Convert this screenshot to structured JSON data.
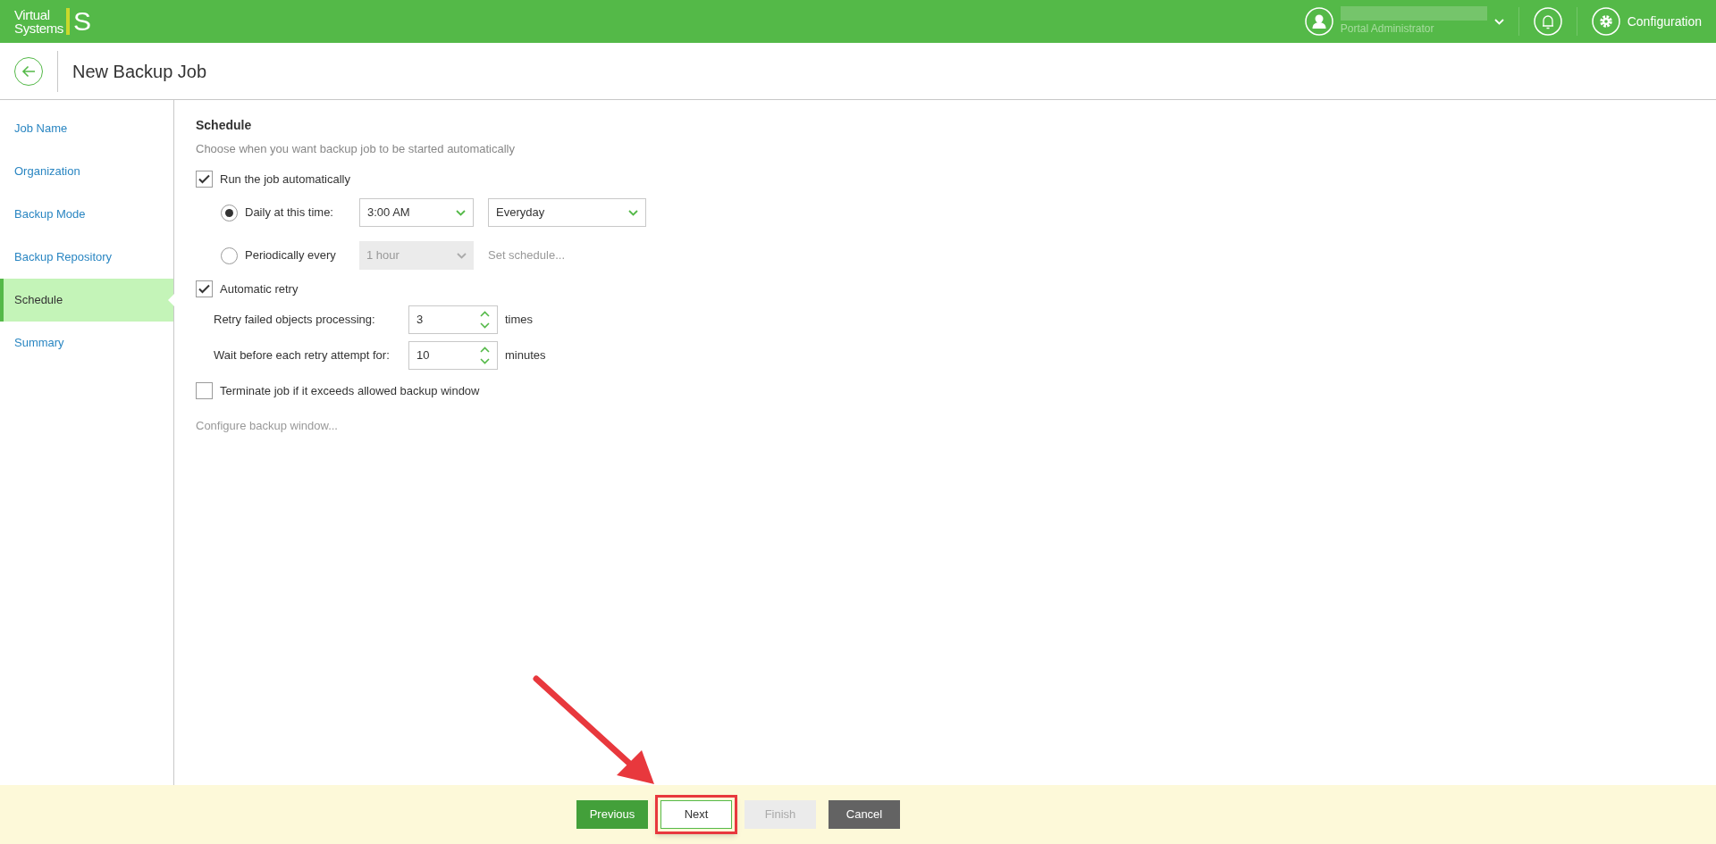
{
  "brand": {
    "line1": "Virtual",
    "line2": "Systems",
    "mark": "S"
  },
  "user": {
    "role": "Portal Administrator"
  },
  "config": {
    "label": "Configuration"
  },
  "page_title": "New Backup Job",
  "steps": [
    {
      "label": "Job Name",
      "selected": false
    },
    {
      "label": "Organization",
      "selected": false
    },
    {
      "label": "Backup Mode",
      "selected": false
    },
    {
      "label": "Backup Repository",
      "selected": false
    },
    {
      "label": "Schedule",
      "selected": true
    },
    {
      "label": "Summary",
      "selected": false
    }
  ],
  "section": {
    "title": "Schedule",
    "subtitle": "Choose when you want backup job to be started automatically"
  },
  "run_auto": {
    "label": "Run the job automatically",
    "checked": true
  },
  "daily": {
    "label": "Daily at this time:",
    "selected": true,
    "time": "3:00 AM",
    "days": "Everyday"
  },
  "periodic": {
    "label": "Periodically every",
    "selected": false,
    "interval": "1 hour",
    "disabled": true,
    "link": "Set schedule..."
  },
  "retry": {
    "label": "Automatic retry",
    "checked": true
  },
  "spinners": [
    {
      "label": "Retry failed objects processing:",
      "value": "3",
      "unit": "times"
    },
    {
      "label": "Wait before each retry attempt for:",
      "value": "10",
      "unit": "minutes"
    }
  ],
  "terminate": {
    "label": "Terminate job if it exceeds allowed backup window",
    "checked": false
  },
  "configure_link": {
    "label": "Configure backup window...",
    "disabled": true
  },
  "buttons": [
    {
      "label": "Previous",
      "kind": "primary",
      "highlighted": false
    },
    {
      "label": "Next",
      "kind": "default",
      "highlighted": true
    },
    {
      "label": "Finish",
      "kind": "disabled",
      "highlighted": false
    },
    {
      "label": "Cancel",
      "kind": "dark",
      "highlighted": false
    }
  ]
}
